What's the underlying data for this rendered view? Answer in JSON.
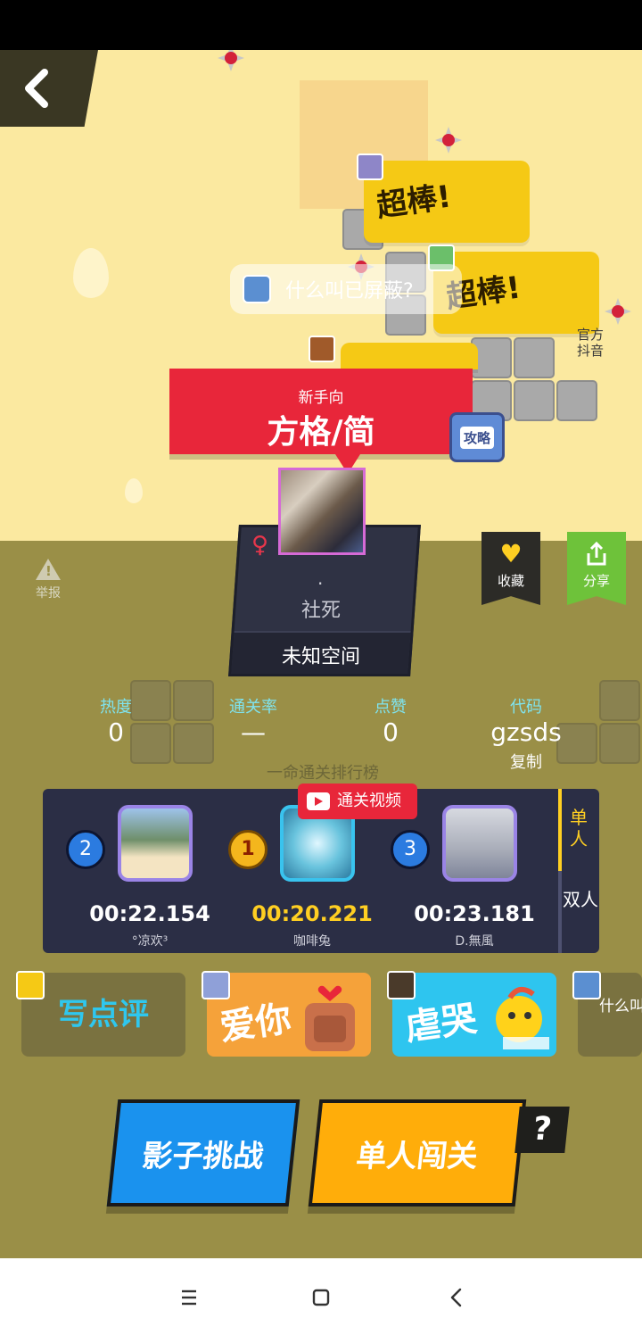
{
  "level": {
    "tag": "新手向",
    "title": "方格/简"
  },
  "comment_bubble": "什么叫已屏蔽?",
  "reactions_floating": [
    "超棒!",
    "超棒!"
  ],
  "official": "官方抖音",
  "guide": "攻略",
  "author": {
    "dot": "·",
    "name": "社死",
    "space": "未知空间"
  },
  "report": "举报",
  "favorite": "收藏",
  "share": "分享",
  "stats": {
    "heat_label": "热度",
    "heat_value": "0",
    "clear_label": "通关率",
    "clear_value": "—",
    "likes_label": "点赞",
    "likes_value": "0",
    "code_label": "代码",
    "code_value": "gzsds",
    "copy_label": "复制"
  },
  "leaderboard": {
    "title": "一命通关排行榜",
    "video_badge": "通关视频",
    "tabs": [
      "单人",
      "双人"
    ],
    "entries": [
      {
        "rank": "2",
        "time": "00:22.154",
        "name": "°凉欢³"
      },
      {
        "rank": "1",
        "time": "00:20.221",
        "name": "咖啡兔"
      },
      {
        "rank": "3",
        "time": "00:23.181",
        "name": "D.無風"
      }
    ]
  },
  "reactions": {
    "write": "写点评",
    "love": "爱你",
    "cry": "虐哭",
    "more": "什么叫一脸"
  },
  "actions": {
    "shadow": "影子挑战",
    "single": "单人闯关",
    "help": "?"
  },
  "colors": {
    "sky": "#fbe9a0",
    "ground": "#9a8f47",
    "title_red": "#e8263a",
    "shadow_blue": "#1a92ee",
    "single_orange": "#ffad0a",
    "gold": "#ffcf22"
  }
}
